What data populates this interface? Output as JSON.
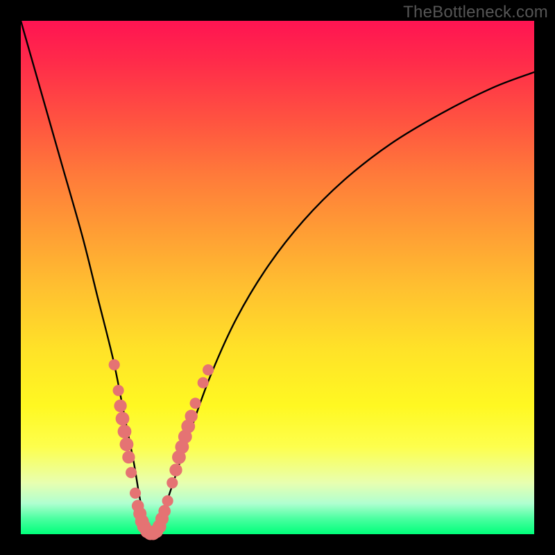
{
  "watermark": "TheBottleneck.com",
  "chart_data": {
    "type": "line",
    "title": "",
    "xlabel": "",
    "ylabel": "",
    "xlim": [
      0,
      100
    ],
    "ylim": [
      0,
      100
    ],
    "background_gradient": {
      "top": "#ff1452",
      "middle": "#fff822",
      "bottom": "#00ff7a"
    },
    "series": [
      {
        "name": "bottleneck-curve",
        "x": [
          0,
          4,
          8,
          12,
          15,
          18,
          20,
          22,
          23,
          24,
          25,
          26,
          27,
          28,
          30,
          33,
          37,
          42,
          48,
          55,
          63,
          72,
          82,
          92,
          100
        ],
        "y": [
          100,
          86,
          72,
          58,
          46,
          34,
          24,
          14,
          8,
          3,
          0,
          0,
          2,
          5,
          11,
          20,
          31,
          42,
          52,
          61,
          69,
          76,
          82,
          87,
          90
        ]
      }
    ],
    "markers": {
      "name": "highlight-dots",
      "color": "#e57373",
      "points": [
        {
          "x": 18.2,
          "y": 33.0,
          "r": 1.1
        },
        {
          "x": 19.0,
          "y": 28.0,
          "r": 1.1
        },
        {
          "x": 19.4,
          "y": 25.0,
          "r": 1.4
        },
        {
          "x": 19.8,
          "y": 22.5,
          "r": 1.6
        },
        {
          "x": 20.2,
          "y": 20.0,
          "r": 1.6
        },
        {
          "x": 20.6,
          "y": 17.5,
          "r": 1.6
        },
        {
          "x": 21.0,
          "y": 15.0,
          "r": 1.4
        },
        {
          "x": 21.5,
          "y": 12.0,
          "r": 1.1
        },
        {
          "x": 22.3,
          "y": 8.0,
          "r": 1.1
        },
        {
          "x": 22.8,
          "y": 5.5,
          "r": 1.3
        },
        {
          "x": 23.2,
          "y": 4.0,
          "r": 1.5
        },
        {
          "x": 23.6,
          "y": 2.5,
          "r": 1.6
        },
        {
          "x": 24.0,
          "y": 1.5,
          "r": 1.6
        },
        {
          "x": 24.6,
          "y": 0.6,
          "r": 1.6
        },
        {
          "x": 25.2,
          "y": 0.2,
          "r": 1.6
        },
        {
          "x": 25.8,
          "y": 0.2,
          "r": 1.6
        },
        {
          "x": 26.4,
          "y": 0.6,
          "r": 1.6
        },
        {
          "x": 27.0,
          "y": 1.5,
          "r": 1.6
        },
        {
          "x": 27.5,
          "y": 3.0,
          "r": 1.5
        },
        {
          "x": 28.0,
          "y": 4.5,
          "r": 1.3
        },
        {
          "x": 28.6,
          "y": 6.5,
          "r": 1.1
        },
        {
          "x": 29.5,
          "y": 10.0,
          "r": 1.1
        },
        {
          "x": 30.2,
          "y": 12.5,
          "r": 1.4
        },
        {
          "x": 30.8,
          "y": 15.0,
          "r": 1.6
        },
        {
          "x": 31.4,
          "y": 17.0,
          "r": 1.6
        },
        {
          "x": 32.0,
          "y": 19.0,
          "r": 1.6
        },
        {
          "x": 32.6,
          "y": 21.0,
          "r": 1.6
        },
        {
          "x": 33.2,
          "y": 23.0,
          "r": 1.4
        },
        {
          "x": 34.0,
          "y": 25.5,
          "r": 1.1
        },
        {
          "x": 35.5,
          "y": 29.5,
          "r": 1.1
        },
        {
          "x": 36.5,
          "y": 32.0,
          "r": 1.1
        }
      ]
    }
  }
}
